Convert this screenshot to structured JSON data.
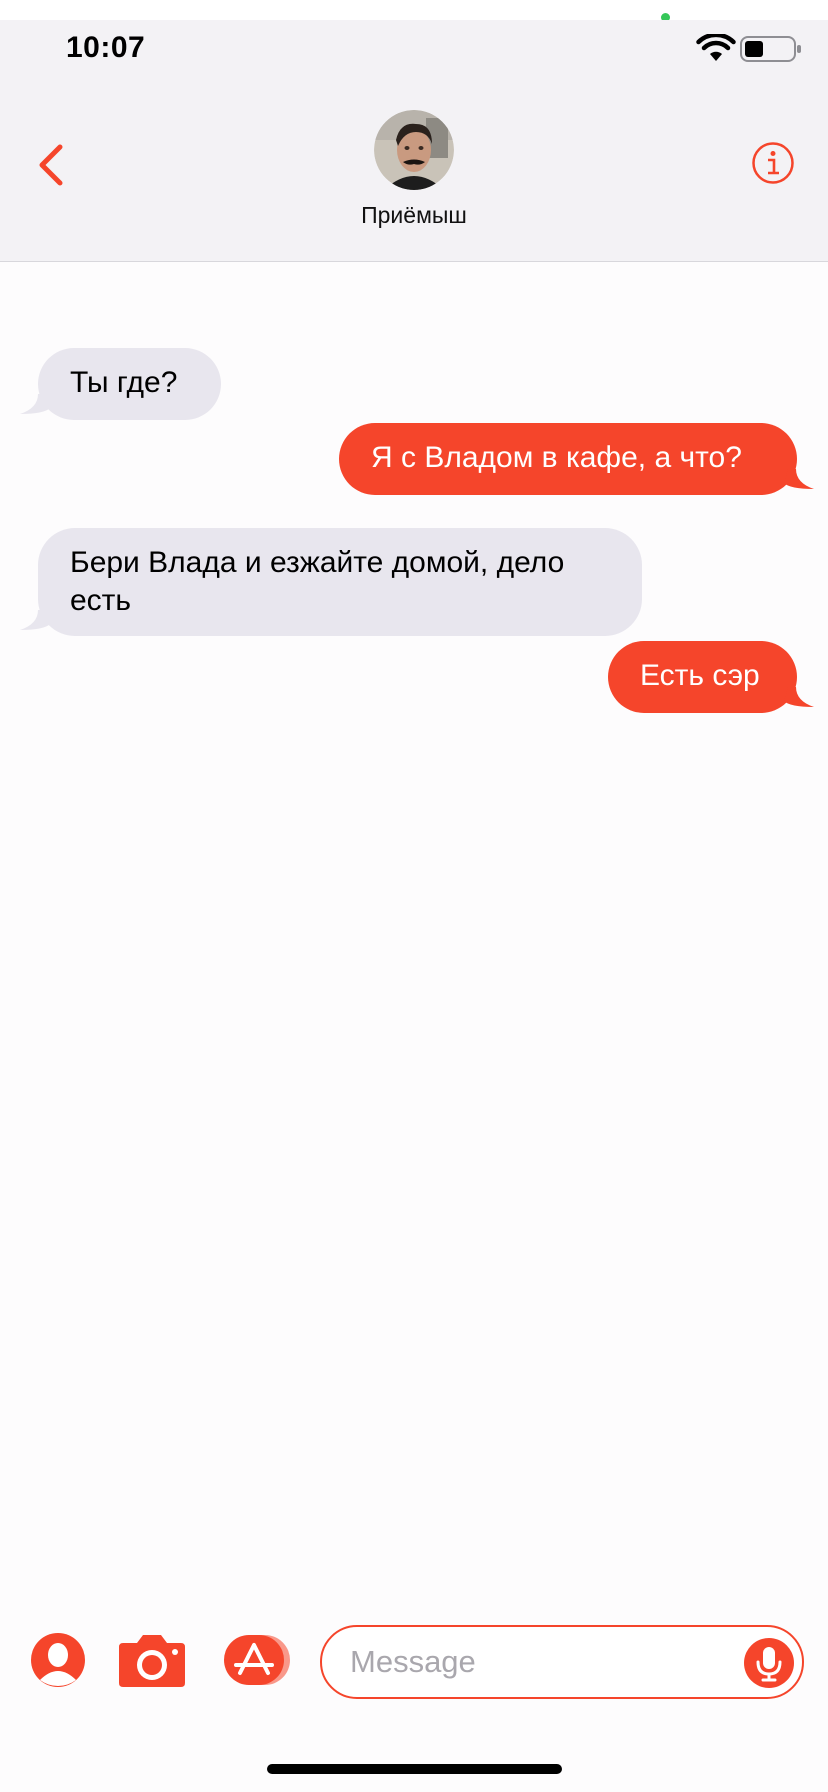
{
  "status_bar": {
    "time": "10:07",
    "icons": [
      "wifi-icon",
      "battery-icon"
    ],
    "indicator_color": "#35c759"
  },
  "header": {
    "back_icon": "chevron-left-icon",
    "avatar_icon": "avatar",
    "contact_name": "Приёмыш",
    "info_icon": "info-icon"
  },
  "messages": [
    {
      "direction": "incoming",
      "text": "Ты где?"
    },
    {
      "direction": "outgoing",
      "text": "Я с Владом в кафе, а что?"
    },
    {
      "direction": "incoming",
      "text": "Бери Влада и езжайте домой, дело есть"
    },
    {
      "direction": "outgoing",
      "text": "Есть сэр"
    }
  ],
  "compose": {
    "placeholder": "Message",
    "value": "",
    "icons": [
      "memoji-icon",
      "camera-icon",
      "app-store-icon",
      "microphone-icon"
    ]
  },
  "colors": {
    "accent": "#f5452b",
    "incoming_bubble": "#e8e6ee",
    "header_background": "#f3f2f5"
  }
}
